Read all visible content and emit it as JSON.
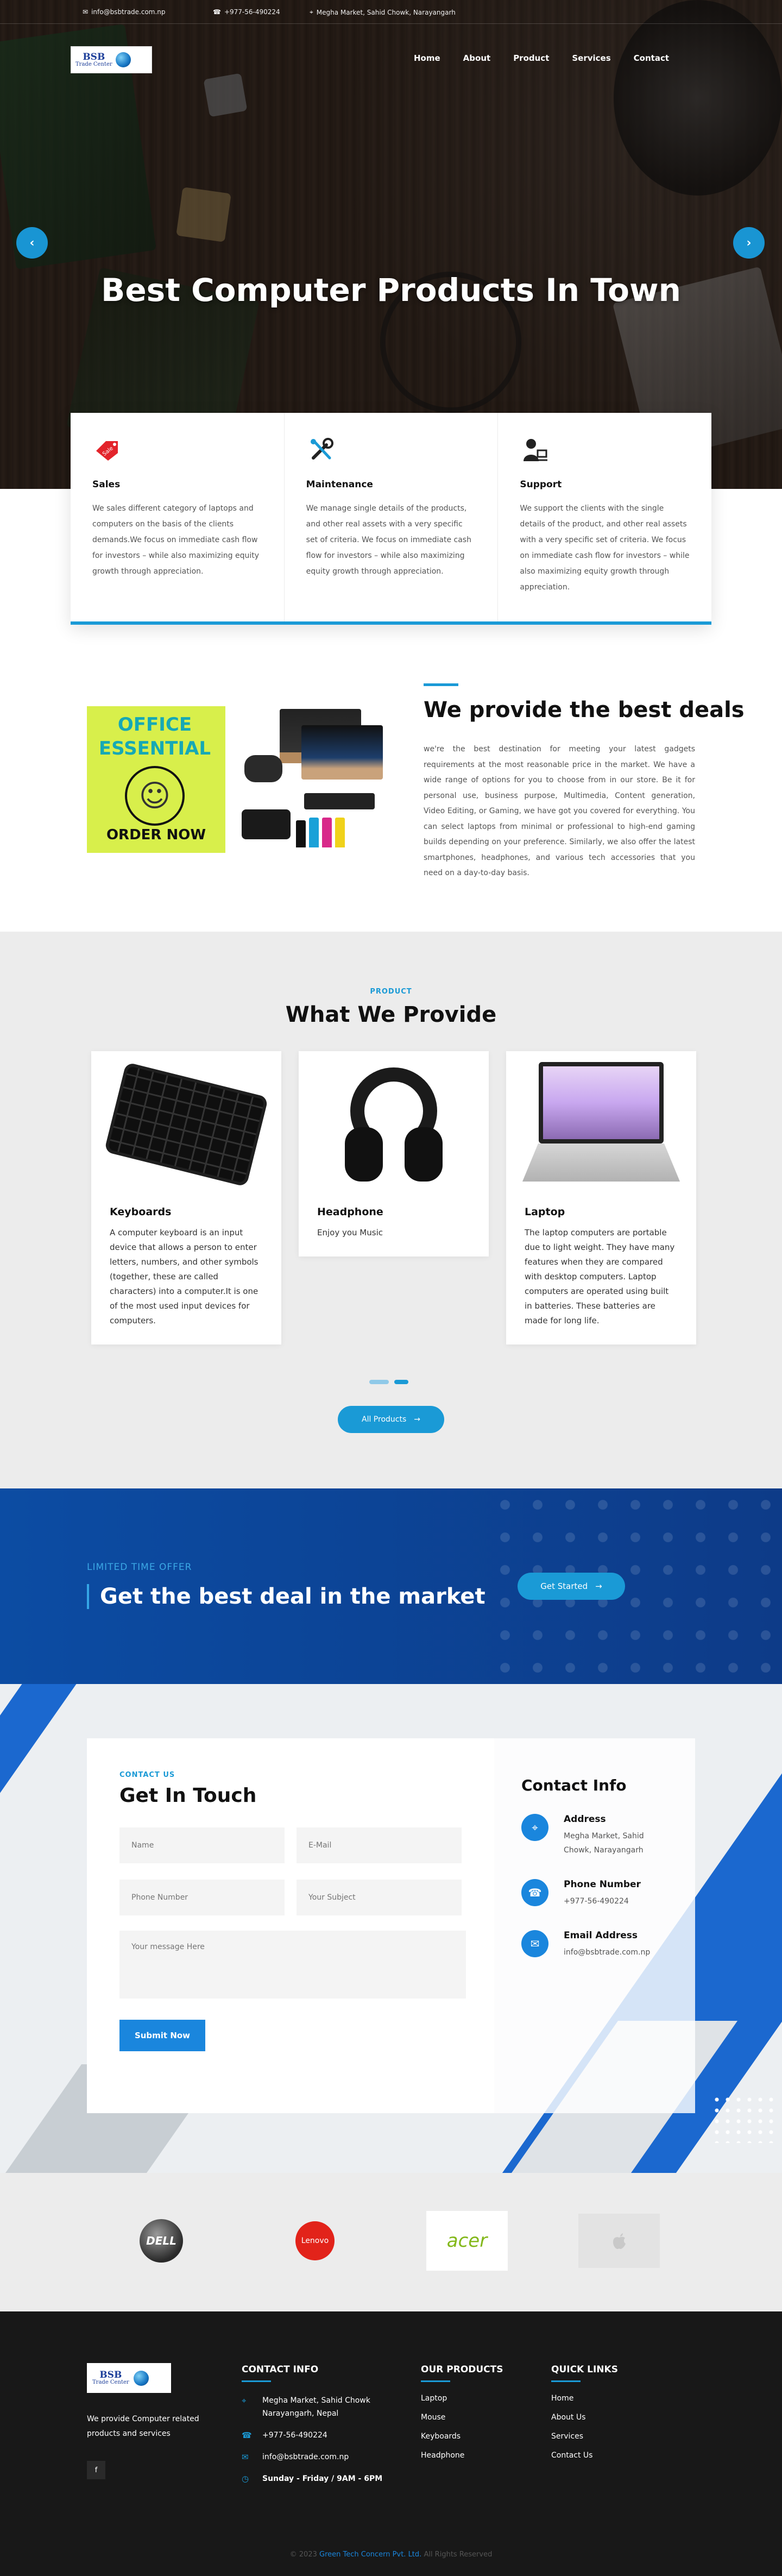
{
  "topbar": {
    "email": "info@bsbtrade.com.np",
    "phone": "+977-56-490224",
    "address": "Megha Market, Sahid Chowk, Narayangarh"
  },
  "logo": {
    "line1": "BSB",
    "line2": "Trade Center"
  },
  "nav": [
    "Home",
    "About",
    "Product",
    "Services",
    "Contact"
  ],
  "hero": {
    "title": "Best Computer Products In Town",
    "prev_icon": "chevron-left-icon",
    "next_icon": "chevron-right-icon"
  },
  "services": [
    {
      "icon": "sale-tag-icon",
      "title": "Sales",
      "text": "We sales different category of laptops and computers on the basis of the clients demands.We focus on immediate cash flow for investors – while also maximizing equity growth through appreciation."
    },
    {
      "icon": "tools-icon",
      "title": "Maintenance",
      "text": "We manage single details of the products, and other real assets with a very specific set of criteria. We focus on immediate cash flow for investors – while also maximizing equity growth through appreciation."
    },
    {
      "icon": "support-agent-icon",
      "title": "Support",
      "text": "We support the clients with the single details of the product, and other real assets with a very specific set of criteria. We focus on immediate cash flow for investors – while also maximizing equity growth through appreciation."
    }
  ],
  "deals": {
    "image": {
      "line1": "OFFICE",
      "line2": "ESSENTIAL",
      "order": "ORDER NOW"
    },
    "title": "We provide the best deals",
    "text": "we're the best destination for meeting your latest gadgets requirements at the most reasonable price in the market. We have a wide range of options for you to choose from in our store. Be it for personal use, business purpose, Multimedia, Content generation, Video Editing, or Gaming, we have got you covered for everything. You can select laptops from minimal or professional to high-end gaming builds depending on your preference. Similarly, we also offer the latest smartphones, headphones, and various tech accessories that you need on a day-to-day basis."
  },
  "products": {
    "eyebrow": "PRODUCT",
    "title": "What We Provide",
    "items": [
      {
        "name": "Keyboards",
        "text": "A computer keyboard is an input device that allows a person to enter letters, numbers, and other symbols (together, these are called characters) into a computer.It is one of the most used input devices for computers."
      },
      {
        "name": "Headphone",
        "text": "Enjoy you Music"
      },
      {
        "name": "Laptop",
        "text": "The laptop computers are portable due to light weight. They have many features when they are compared with desktop computers. Laptop computers are operated using built in batteries. These batteries are made for long life."
      }
    ],
    "button": "All Products"
  },
  "banner": {
    "eyebrow": "LIMITED TIME OFFER",
    "title": "Get the best deal in the market",
    "button": "Get Started"
  },
  "contact": {
    "eyebrow": "CONTACT US",
    "title": "Get In Touch",
    "placeholders": {
      "name": "Name",
      "email": "E-Mail",
      "phone": "Phone Number",
      "subject": "Your Subject",
      "message": "Your message Here"
    },
    "submit": "Submit Now",
    "info_title": "Contact Info",
    "info": [
      {
        "icon": "location-pin-icon",
        "label": "Address",
        "value": "Megha Market, Sahid Chowk, Narayangarh"
      },
      {
        "icon": "phone-icon",
        "label": "Phone Number",
        "value": "+977-56-490224"
      },
      {
        "icon": "mail-icon",
        "label": "Email Address",
        "value": "info@bsbtrade.com.np"
      }
    ]
  },
  "brands": {
    "dell": "DELL",
    "lenovo": "Lenovo",
    "acer": "acer",
    "apple": ""
  },
  "footer": {
    "about": "We provide Computer related products and services",
    "contact_head": "CONTACT INFO",
    "contact_lines": [
      {
        "icon": "location-pin-icon",
        "text": "Megha Market, Sahid Chowk Narayangarh, Nepal"
      },
      {
        "icon": "phone-icon",
        "text": "+977-56-490224"
      },
      {
        "icon": "mail-icon",
        "text": "info@bsbtrade.com.np"
      },
      {
        "icon": "clock-icon",
        "text": "Sunday - Friday / 9AM - 6PM"
      }
    ],
    "products_head": "OUR PRODUCTS",
    "products": [
      "Laptop",
      "Mouse",
      "Keyboards",
      "Headphone"
    ],
    "links_head": "QUICK LINKS",
    "links": [
      "Home",
      "About Us",
      "Services",
      "Contact Us"
    ],
    "copy_pre": "© 2023",
    "copy_company": "Green Tech Concern Pvt. Ltd.",
    "copy_post": "All Rights Reserved",
    "social": "f"
  },
  "colors": {
    "accent": "#1a9ad6",
    "banner": "#0c4ca3",
    "footer": "#181818"
  }
}
